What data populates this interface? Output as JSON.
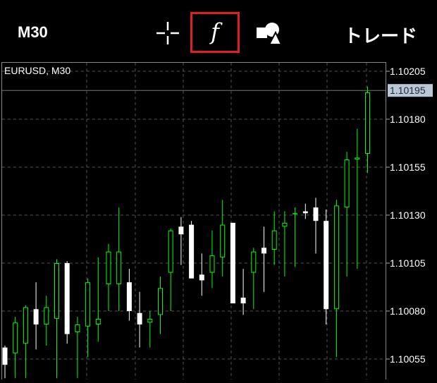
{
  "toolbar": {
    "timeframe_label": "M30",
    "crosshair_icon": "crosshair-icon",
    "indicator_label": "f",
    "objects_icon": "shapes-icon",
    "trade_label": "トレード"
  },
  "chart": {
    "symbol_label": "EURUSD, M30",
    "current_price": "1.10195",
    "y_axis_ticks": [
      "1.10205",
      "1.10180",
      "1.10155",
      "1.10130",
      "1.10105",
      "1.10080",
      "1.10055"
    ],
    "colors": {
      "background": "#000000",
      "bull_candle": "#00ff00",
      "bear_candle": "#ffffff",
      "grid": "#555555",
      "price_label_bg": "#b9c7d6",
      "highlight_border": "#e02020"
    }
  },
  "chart_data": {
    "type": "candlestick",
    "title": "EURUSD, M30",
    "y_axis_labels": [
      "1.10205",
      "1.10180",
      "1.10155",
      "1.10130",
      "1.10105",
      "1.10080",
      "1.10055"
    ],
    "ylim": [
      1.10045,
      1.1021
    ],
    "grid": true,
    "candles": [
      {
        "o": 1.10061,
        "h": 1.10062,
        "l": 1.10045,
        "c": 1.10052
      },
      {
        "o": 1.10058,
        "h": 1.10077,
        "l": 1.10045,
        "c": 1.10074
      },
      {
        "o": 1.10063,
        "h": 1.10083,
        "l": 1.10045,
        "c": 1.10082
      },
      {
        "o": 1.10081,
        "h": 1.10095,
        "l": 1.1006,
        "c": 1.10073
      },
      {
        "o": 1.10073,
        "h": 1.10088,
        "l": 1.10062,
        "c": 1.10082
      },
      {
        "o": 1.10076,
        "h": 1.10107,
        "l": 1.10045,
        "c": 1.10105
      },
      {
        "o": 1.10105,
        "h": 1.10106,
        "l": 1.10063,
        "c": 1.10068
      },
      {
        "o": 1.10069,
        "h": 1.10077,
        "l": 1.10045,
        "c": 1.10073
      },
      {
        "o": 1.10072,
        "h": 1.10097,
        "l": 1.10056,
        "c": 1.10095
      },
      {
        "o": 1.10073,
        "h": 1.10108,
        "l": 1.10064,
        "c": 1.10076
      },
      {
        "o": 1.10094,
        "h": 1.10115,
        "l": 1.1008,
        "c": 1.10111
      },
      {
        "o": 1.10094,
        "h": 1.10134,
        "l": 1.1008,
        "c": 1.10111
      },
      {
        "o": 1.10095,
        "h": 1.10102,
        "l": 1.10075,
        "c": 1.1008
      },
      {
        "o": 1.10079,
        "h": 1.1009,
        "l": 1.10061,
        "c": 1.10073
      },
      {
        "o": 1.10074,
        "h": 1.1008,
        "l": 1.10061,
        "c": 1.10076
      },
      {
        "o": 1.10078,
        "h": 1.10098,
        "l": 1.10068,
        "c": 1.10092
      },
      {
        "o": 1.101,
        "h": 1.10123,
        "l": 1.1008,
        "c": 1.10122
      },
      {
        "o": 1.10124,
        "h": 1.10129,
        "l": 1.10104,
        "c": 1.1012
      },
      {
        "o": 1.10125,
        "h": 1.10127,
        "l": 1.10099,
        "c": 1.10097
      },
      {
        "o": 1.10099,
        "h": 1.1011,
        "l": 1.10088,
        "c": 1.10096
      },
      {
        "o": 1.101,
        "h": 1.10122,
        "l": 1.10092,
        "c": 1.10109
      },
      {
        "o": 1.10108,
        "h": 1.10138,
        "l": 1.10098,
        "c": 1.10125
      },
      {
        "o": 1.10126,
        "h": 1.10126,
        "l": 1.10086,
        "c": 1.10084
      },
      {
        "o": 1.10087,
        "h": 1.10102,
        "l": 1.10078,
        "c": 1.10084
      },
      {
        "o": 1.101,
        "h": 1.10113,
        "l": 1.10081,
        "c": 1.10111
      },
      {
        "o": 1.10113,
        "h": 1.10124,
        "l": 1.1009,
        "c": 1.1011
      },
      {
        "o": 1.10112,
        "h": 1.10132,
        "l": 1.10104,
        "c": 1.10122
      },
      {
        "o": 1.10124,
        "h": 1.10132,
        "l": 1.10098,
        "c": 1.10126
      },
      {
        "o": 1.10131,
        "h": 1.10134,
        "l": 1.10103,
        "c": 1.10131
      },
      {
        "o": 1.10132,
        "h": 1.10136,
        "l": 1.10128,
        "c": 1.10131
      },
      {
        "o": 1.10134,
        "h": 1.10139,
        "l": 1.1011,
        "c": 1.10127
      },
      {
        "o": 1.10127,
        "h": 1.10133,
        "l": 1.10073,
        "c": 1.10081
      },
      {
        "o": 1.10081,
        "h": 1.10138,
        "l": 1.10056,
        "c": 1.10135
      },
      {
        "o": 1.10134,
        "h": 1.10163,
        "l": 1.10098,
        "c": 1.10159
      },
      {
        "o": 1.10159,
        "h": 1.10175,
        "l": 1.10102,
        "c": 1.1016
      },
      {
        "o": 1.10162,
        "h": 1.10197,
        "l": 1.10152,
        "c": 1.10194
      }
    ]
  }
}
